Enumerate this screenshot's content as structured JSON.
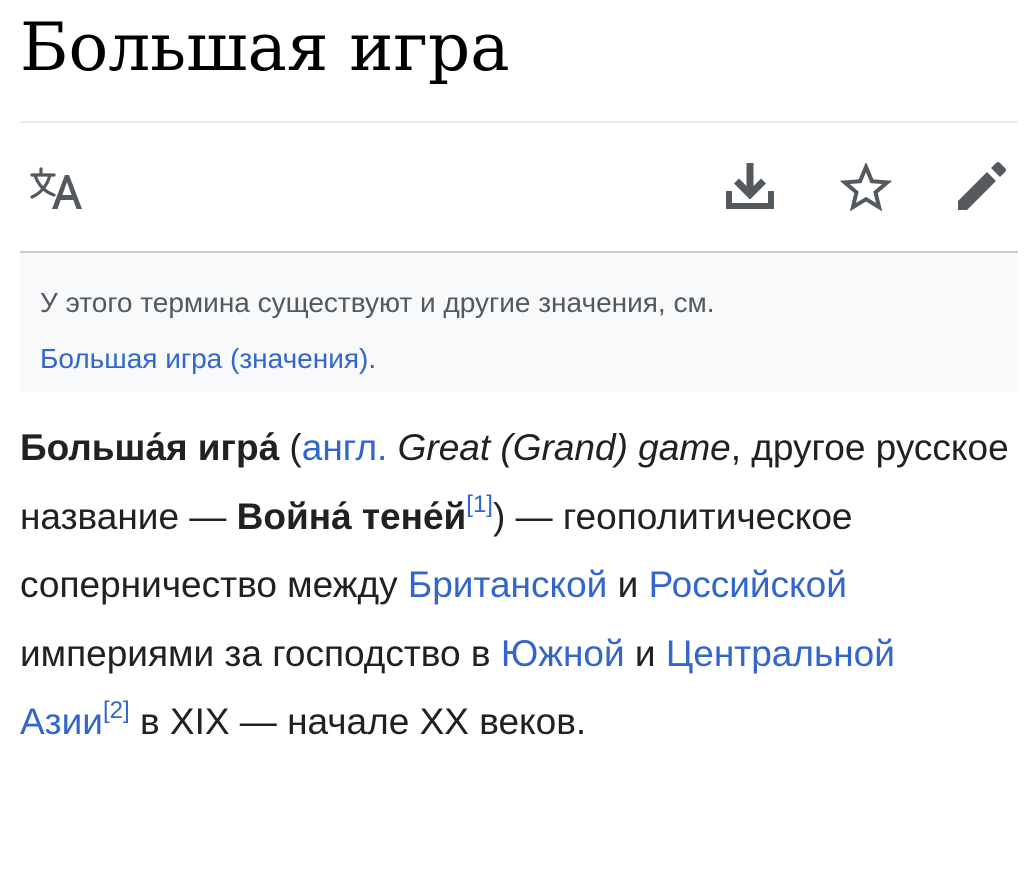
{
  "article": {
    "title": "Большая игра"
  },
  "toolbar": {
    "icons": [
      "language-icon",
      "download-icon",
      "star-icon",
      "edit-pencil-icon"
    ]
  },
  "hatnote": {
    "text": "У этого термина существуют и другие значения, см.",
    "link": "Большая игра (значения)",
    "end": "."
  },
  "lead": {
    "term_bold": "Больша́я игра́",
    "open_paren": " (",
    "lang_abbr_link": "англ.",
    "space": " ",
    "english_italic": "Great (Grand) game",
    "alt_intro": ", другое русское название — ",
    "alt_name_bold": "Война́ тене́й",
    "ref1": "[1]",
    "close_dash": ") — геополитическое соперничество между ",
    "link_british": "Британской",
    "and1": " и ",
    "link_russian": "Российской",
    "empires_text": " империями за господство в ",
    "link_south": "Южной",
    "and2": " и ",
    "link_central_asia": "Центральной Азии",
    "ref2": "[2]",
    "ending": " в XIX — начале XX веков."
  },
  "colors": {
    "link": "#3366cc",
    "text": "#202122",
    "hatnote_bg": "#f8f9fa",
    "hatnote_text": "#54595d",
    "icon": "#54595d"
  }
}
